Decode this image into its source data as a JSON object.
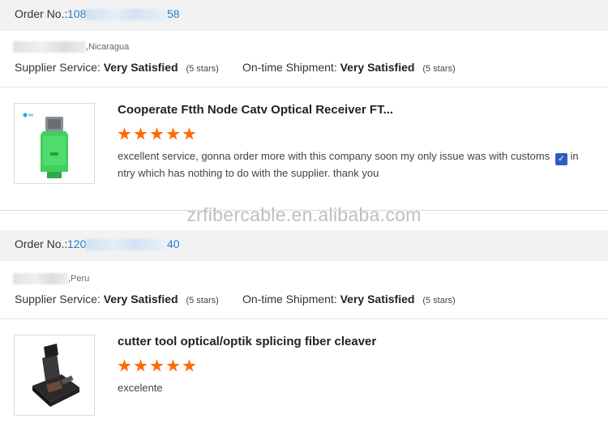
{
  "watermark": "zrfibercable.en.alibaba.com",
  "orders": [
    {
      "order_label": "Order No.:",
      "order_prefix": "108",
      "order_suffix": "58",
      "country": ",Nicaragua",
      "supplier_service_label": "Supplier Service:",
      "supplier_service_value": "Very Satisfied",
      "supplier_service_stars": "(5 stars)",
      "shipment_label": "On-time Shipment:",
      "shipment_value": "Very Satisfied",
      "shipment_stars": "(5 stars)",
      "product_title": "Cooperate Ftth Node Catv Optical Receiver FT...",
      "rating": 5,
      "review_line1": "excellent service, gonna order more with this company soon my only issue was with customs",
      "review_flag_text": "in",
      "review_line2": "ntry which has nothing to do with the supplier. thank you",
      "thumb_icon": "optical-receiver-product-photo"
    },
    {
      "order_label": "Order No.:",
      "order_prefix": "120",
      "order_suffix": "40",
      "country": ",Peru",
      "supplier_service_label": "Supplier Service:",
      "supplier_service_value": "Very Satisfied",
      "supplier_service_stars": "(5 stars)",
      "shipment_label": "On-time Shipment:",
      "shipment_value": "Very Satisfied",
      "shipment_stars": "(5 stars)",
      "product_title": "cutter tool optical/optik splicing fiber cleaver",
      "rating": 5,
      "review_line1": "excelente",
      "thumb_icon": "fiber-cleaver-product-photo"
    }
  ],
  "colors": {
    "link": "#2a7bd1",
    "star": "#ff6a00",
    "bar": "#f2f2f2"
  }
}
